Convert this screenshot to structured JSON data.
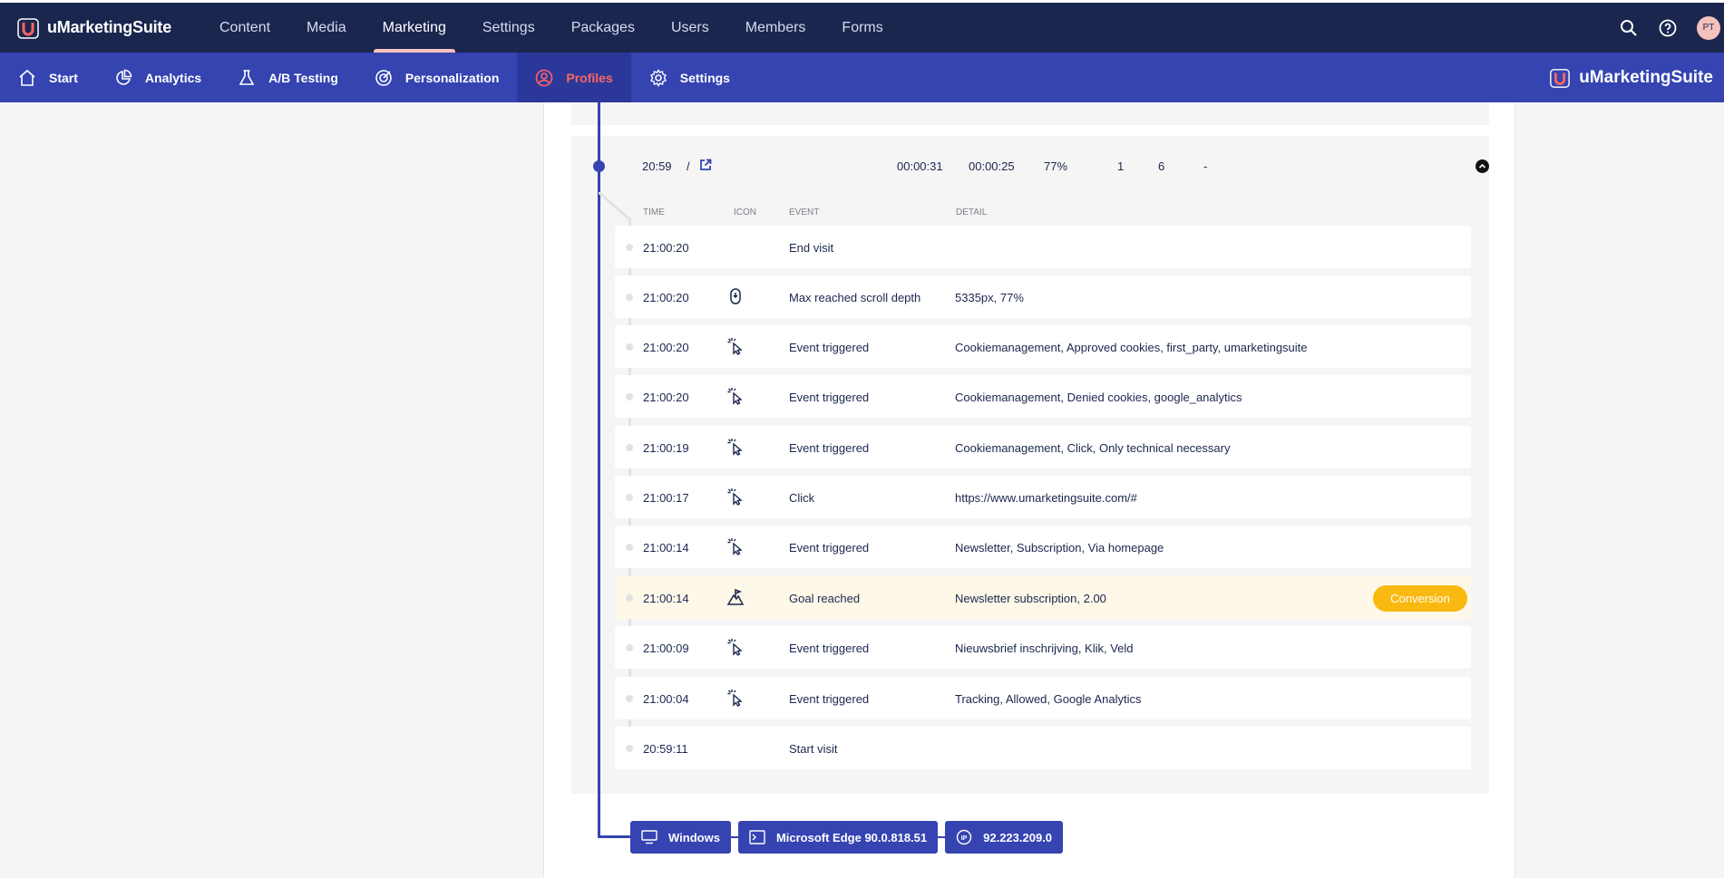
{
  "app": {
    "brand": "uMarketingSuite"
  },
  "topnav": {
    "items": [
      "Content",
      "Media",
      "Marketing",
      "Settings",
      "Packages",
      "Users",
      "Members",
      "Forms"
    ],
    "active": "Marketing"
  },
  "topright": {
    "avatar": "PT"
  },
  "subnav": {
    "items": [
      {
        "label": "Start",
        "icon": "home-icon"
      },
      {
        "label": "Analytics",
        "icon": "pie-chart-icon"
      },
      {
        "label": "A/B Testing",
        "icon": "flask-icon"
      },
      {
        "label": "Personalization",
        "icon": "target-icon"
      },
      {
        "label": "Profiles",
        "icon": "profile-icon"
      },
      {
        "label": "Settings",
        "icon": "gear-icon"
      }
    ],
    "active": "Profiles",
    "brand": "uMarketingSuite"
  },
  "session": {
    "start_time": "20:59",
    "page": "/",
    "duration": "00:00:31",
    "time_on_page": "00:00:25",
    "scroll_depth": "77%",
    "pages": "1",
    "events": "6",
    "extra": "-"
  },
  "table": {
    "headers": {
      "time": "TIME",
      "icon": "ICON",
      "event": "EVENT",
      "detail": "DETAIL"
    },
    "rows": [
      {
        "time": "21:00:20",
        "icon": "",
        "event": "End visit",
        "detail": ""
      },
      {
        "time": "21:00:20",
        "icon": "scroll-icon",
        "event": "Max reached scroll depth",
        "detail": "5335px, 77%"
      },
      {
        "time": "21:00:20",
        "icon": "click-cursor-icon",
        "event": "Event triggered",
        "detail": "Cookiemanagement, Approved cookies, first_party, umarketingsuite"
      },
      {
        "time": "21:00:20",
        "icon": "click-cursor-icon",
        "event": "Event triggered",
        "detail": "Cookiemanagement, Denied cookies, google_analytics"
      },
      {
        "time": "21:00:19",
        "icon": "click-cursor-icon",
        "event": "Event triggered",
        "detail": "Cookiemanagement, Click, Only technical necessary"
      },
      {
        "time": "21:00:17",
        "icon": "click-cursor-icon",
        "event": "Click",
        "detail": "https://www.umarketingsuite.com/#"
      },
      {
        "time": "21:00:14",
        "icon": "click-cursor-icon",
        "event": "Event triggered",
        "detail": "Newsletter, Subscription, Via homepage"
      },
      {
        "time": "21:00:14",
        "icon": "goal-flag-icon",
        "event": "Goal reached",
        "detail": "Newsletter subscription, 2.00",
        "badge": "Conversion"
      },
      {
        "time": "21:00:09",
        "icon": "click-cursor-icon",
        "event": "Event triggered",
        "detail": "Nieuwsbrief inschrijving, Klik, Veld"
      },
      {
        "time": "21:00:04",
        "icon": "click-cursor-icon",
        "event": "Event triggered",
        "detail": "Tracking, Allowed, Google Analytics"
      },
      {
        "time": "20:59:11",
        "icon": "",
        "event": "Start visit",
        "detail": ""
      }
    ]
  },
  "chips": [
    {
      "label": "Windows",
      "icon": "monitor-icon"
    },
    {
      "label": "Microsoft Edge 90.0.818.51",
      "icon": "browser-icon"
    },
    {
      "label": "92.223.209.0",
      "icon": "ip-icon"
    }
  ],
  "colors": {
    "top_bar": "#1b264f",
    "sub_bar": "#3544b1",
    "active_accent": "#fe6561",
    "conversion": "#f9b910",
    "highlight_row": "#fef8e8"
  }
}
